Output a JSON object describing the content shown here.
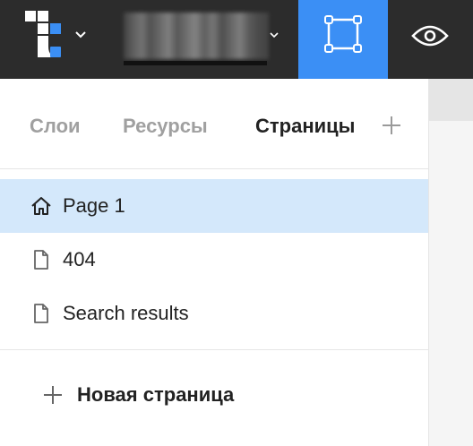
{
  "topbar": {
    "logo_icon": "app-logo-icon",
    "logo_menu_icon": "chevron-down-icon",
    "project_name_blurred": true,
    "project_menu_icon": "chevron-down-icon",
    "frame_tool_icon": "frame-tool-icon",
    "frame_tool_active_color": "#3b8ff5",
    "preview_icon": "eye-icon"
  },
  "tabs": {
    "items": [
      {
        "label": "Слои",
        "active": false
      },
      {
        "label": "Ресурсы",
        "active": false
      },
      {
        "label": "Страницы",
        "active": true
      }
    ],
    "add_icon": "plus-icon"
  },
  "pages": {
    "items": [
      {
        "label": "Page 1",
        "icon": "home-icon",
        "selected": true
      },
      {
        "label": "404",
        "icon": "file-icon",
        "selected": false
      },
      {
        "label": "Search results",
        "icon": "file-icon",
        "selected": false
      }
    ],
    "selected_color": "#d4e8fb"
  },
  "new_page": {
    "label": "Новая страница",
    "icon": "plus-icon"
  }
}
